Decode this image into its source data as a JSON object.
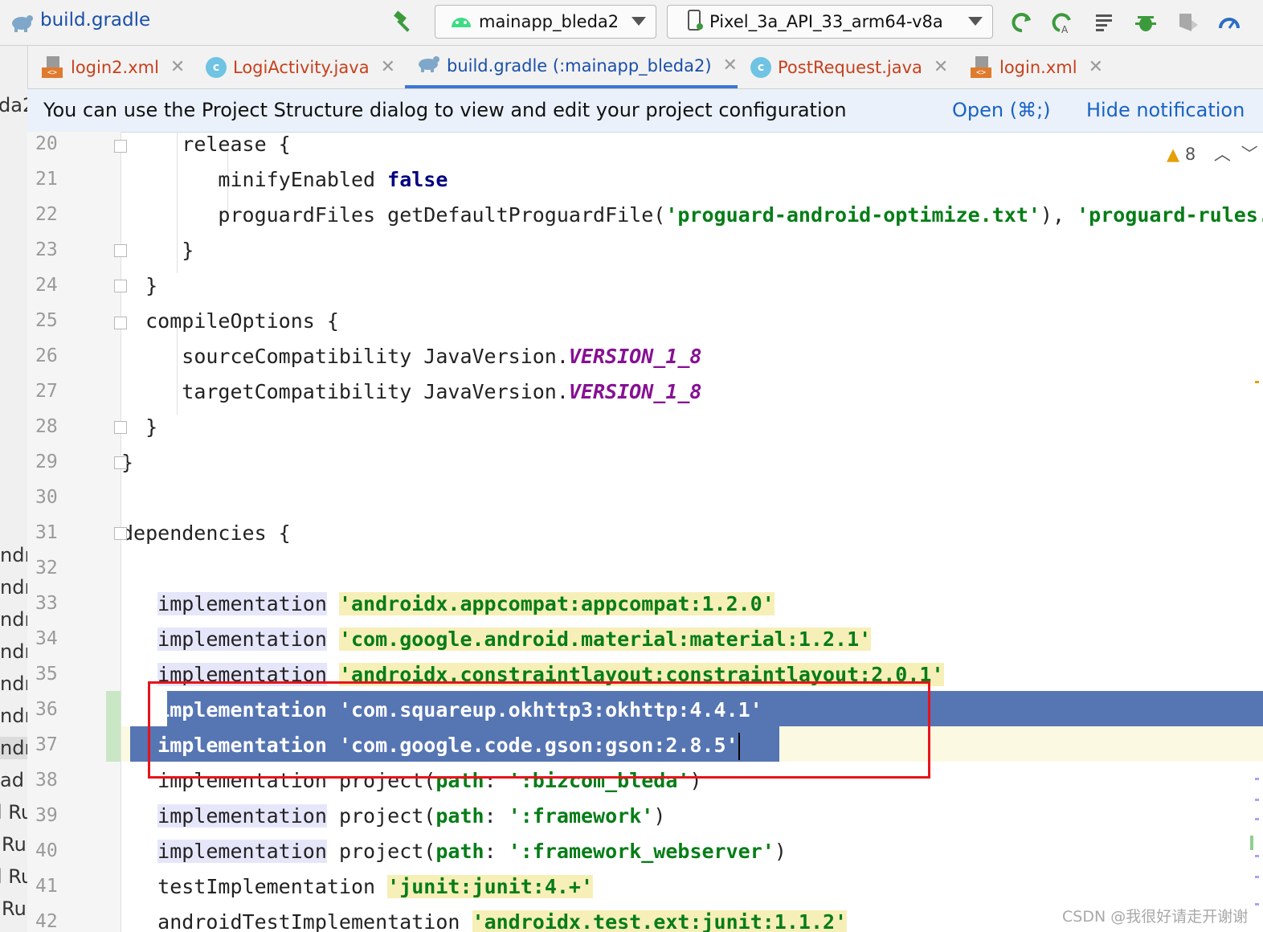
{
  "toolbar": {
    "title": "build.gradle",
    "module_dropdown": "mainapp_bleda2",
    "device_dropdown": "Pixel_3a_API_33_arm64-v8a"
  },
  "tabs": [
    {
      "label": "login2.xml",
      "type": "xml"
    },
    {
      "label": "LogiActivity.java",
      "type": "class"
    },
    {
      "label": "build.gradle (:mainapp_bleda2)",
      "type": "gradle",
      "active": true
    },
    {
      "label": "PostRequest.java",
      "type": "class"
    },
    {
      "label": "login.xml",
      "type": "xml"
    }
  ],
  "notification": {
    "message": "You can use the Project Structure dialog to view and edit your project configuration",
    "open_link": "Open (⌘;)",
    "hide_link": "Hide notification"
  },
  "left_strip": {
    "top_text": "da2",
    "items": [
      "ndr",
      "ndr",
      "ndr",
      "ndr",
      "ndr",
      "ndr",
      "ndr",
      "ad",
      "l Ru",
      "Ru",
      "l Ru",
      "Ru"
    ]
  },
  "warnings": {
    "count": "8"
  },
  "code": {
    "line_numbers": [
      "20",
      "21",
      "22",
      "23",
      "24",
      "25",
      "26",
      "27",
      "28",
      "29",
      "30",
      "31",
      "32",
      "33",
      "34",
      "35",
      "36",
      "37",
      "38",
      "39",
      "40",
      "41",
      "42"
    ],
    "l20": "release {",
    "l21a": "minifyEnabled ",
    "l21b": "false",
    "l22a": "proguardFiles getDefaultProguardFile(",
    "l22b": "'proguard-android-optimize.txt'",
    "l22c": "), ",
    "l22d": "'proguard-rules.pro'",
    "l23": "}",
    "l24": "}",
    "l25": "compileOptions {",
    "l26a": "sourceCompatibility JavaVersion.",
    "l26b": "VERSION_1_8",
    "l27a": "targetCompatibility JavaVersion.",
    "l27b": "VERSION_1_8",
    "l28": "}",
    "l29": "}",
    "l31": "dependencies {",
    "impl": "implementation",
    "l33s": "'androidx.appcompat:appcompat:1.2.0'",
    "l34s": "'com.google.android.material:material:1.2.1'",
    "l35s": "'androidx.constraintlayout:constraintlayout:2.0.1'",
    "l36s": "'com.squareup.okhttp3:okhttp:4.4.1'",
    "l37s": "'com.google.code.gson:gson:2.8.5'",
    "proj": "project(",
    "path": "path",
    "l38s": "':bizcom_bleda'",
    "l39s": "':framework'",
    "l40s": "':framework_webserver'",
    "l41a": "testImplementation",
    "l41s": "'junit:junit:4.+'",
    "l42a": "androidTestImplementation",
    "l42s": "'androidx.test.ext:junit:1.1.2'"
  },
  "watermark": "CSDN @我很好请走开谢谢"
}
